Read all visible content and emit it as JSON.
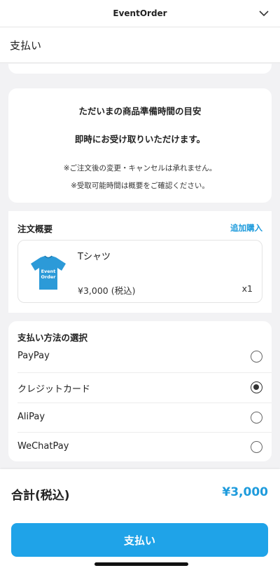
{
  "topbar": {
    "title": "EventOrder"
  },
  "header": {
    "title": "支払い"
  },
  "notice": {
    "title": "ただいまの商品準備時間の目安",
    "subtitle": "即時にお受け取りいただけます。",
    "note1": "※ご注文後の変更・キャンセルは承れません。",
    "note2": "※受取可能時間は概要をご確認ください。"
  },
  "order": {
    "label": "注文概要",
    "add_label": "追加購入",
    "item": {
      "name": "Tシャツ",
      "price": "¥3,000 (税込)",
      "qty": "x1",
      "shirt_text_1": "Event",
      "shirt_text_2": "Order",
      "shirt_color": "#2c9ad8"
    }
  },
  "payment": {
    "label": "支払い方法の選択",
    "options": [
      {
        "name": "PayPay",
        "selected": false
      },
      {
        "name": "クレジットカード",
        "selected": true
      },
      {
        "name": "AliPay",
        "selected": false
      },
      {
        "name": "WeChatPay",
        "selected": false
      }
    ]
  },
  "footer": {
    "total_label": "合計(税込)",
    "total_value": "¥3,000",
    "pay_button": "支払い"
  },
  "colors": {
    "accent": "#1fa3e8",
    "link": "#1e9bdc"
  }
}
